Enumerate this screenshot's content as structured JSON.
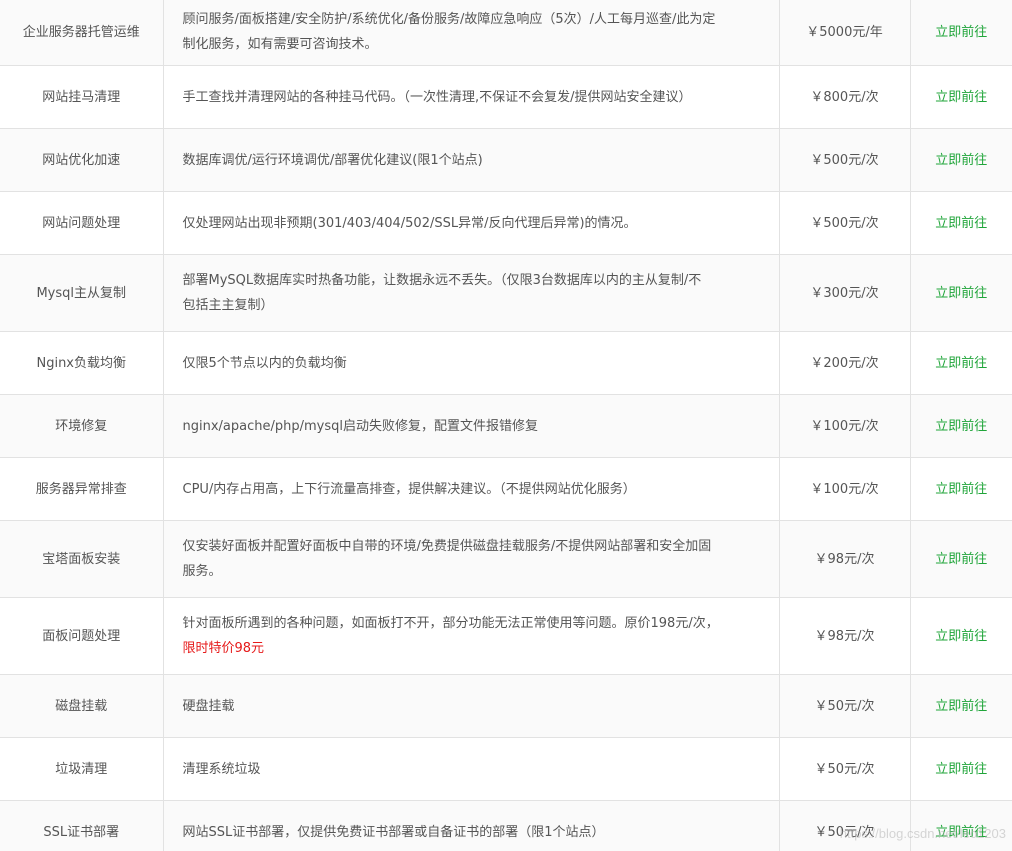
{
  "action_label": "立即前往",
  "rows": [
    {
      "name": "企业服务器托管运维",
      "desc_lines": [
        "顾问服务/面板搭建/安全防护/系统优化/备份服务/故障应急响应（5次）/人工每月巡查/此为定",
        "制化服务，如有需要可咨询技术。"
      ],
      "price": "￥5000元/年"
    },
    {
      "name": "网站挂马清理",
      "desc_lines": [
        "手工查找并清理网站的各种挂马代码。（一次性清理,不保证不会复发/提供网站安全建议）"
      ],
      "price": "￥800元/次"
    },
    {
      "name": "网站优化加速",
      "desc_lines": [
        "数据库调优/运行环境调优/部署优化建议(限1个站点)"
      ],
      "price": "￥500元/次"
    },
    {
      "name": "网站问题处理",
      "desc_lines": [
        "仅处理网站出现非预期(301/403/404/502/SSL异常/反向代理后异常)的情况。"
      ],
      "price": "￥500元/次"
    },
    {
      "name": "Mysql主从复制",
      "desc_lines": [
        "部署MySQL数据库实时热备功能，让数据永远不丢失。（仅限3台数据库以内的主从复制/不",
        "包括主主复制）"
      ],
      "price": "￥300元/次"
    },
    {
      "name": "Nginx负载均衡",
      "desc_lines": [
        "仅限5个节点以内的负载均衡"
      ],
      "price": "￥200元/次"
    },
    {
      "name": "环境修复",
      "desc_lines": [
        "nginx/apache/php/mysql启动失败修复，配置文件报错修复"
      ],
      "price": "￥100元/次"
    },
    {
      "name": "服务器异常排查",
      "desc_lines": [
        "CPU/内存占用高，上下行流量高排查，提供解决建议。（不提供网站优化服务）"
      ],
      "price": "￥100元/次"
    },
    {
      "name": "宝塔面板安装",
      "desc_lines": [
        "仅安装好面板并配置好面板中自带的环境/免费提供磁盘挂载服务/不提供网站部署和安全加固",
        "服务。"
      ],
      "price": "￥98元/次"
    },
    {
      "name": "面板问题处理",
      "desc_lines": [
        "针对面板所遇到的各种问题，如面板打不开，部分功能无法正常使用等问题。原价198元/次，"
      ],
      "promo": "限时特价98元",
      "price": "￥98元/次"
    },
    {
      "name": "磁盘挂载",
      "desc_lines": [
        "硬盘挂载"
      ],
      "price": "￥50元/次"
    },
    {
      "name": "垃圾清理",
      "desc_lines": [
        "清理系统垃圾"
      ],
      "price": "￥50元/次"
    },
    {
      "name": "SSL证书部署",
      "desc_lines": [
        "网站SSL证书部署，仅提供免费证书部署或自备证书的部署（限1个站点）"
      ],
      "price": "￥50元/次"
    }
  ],
  "watermark": "https://blog.csdn.net/leo1203"
}
